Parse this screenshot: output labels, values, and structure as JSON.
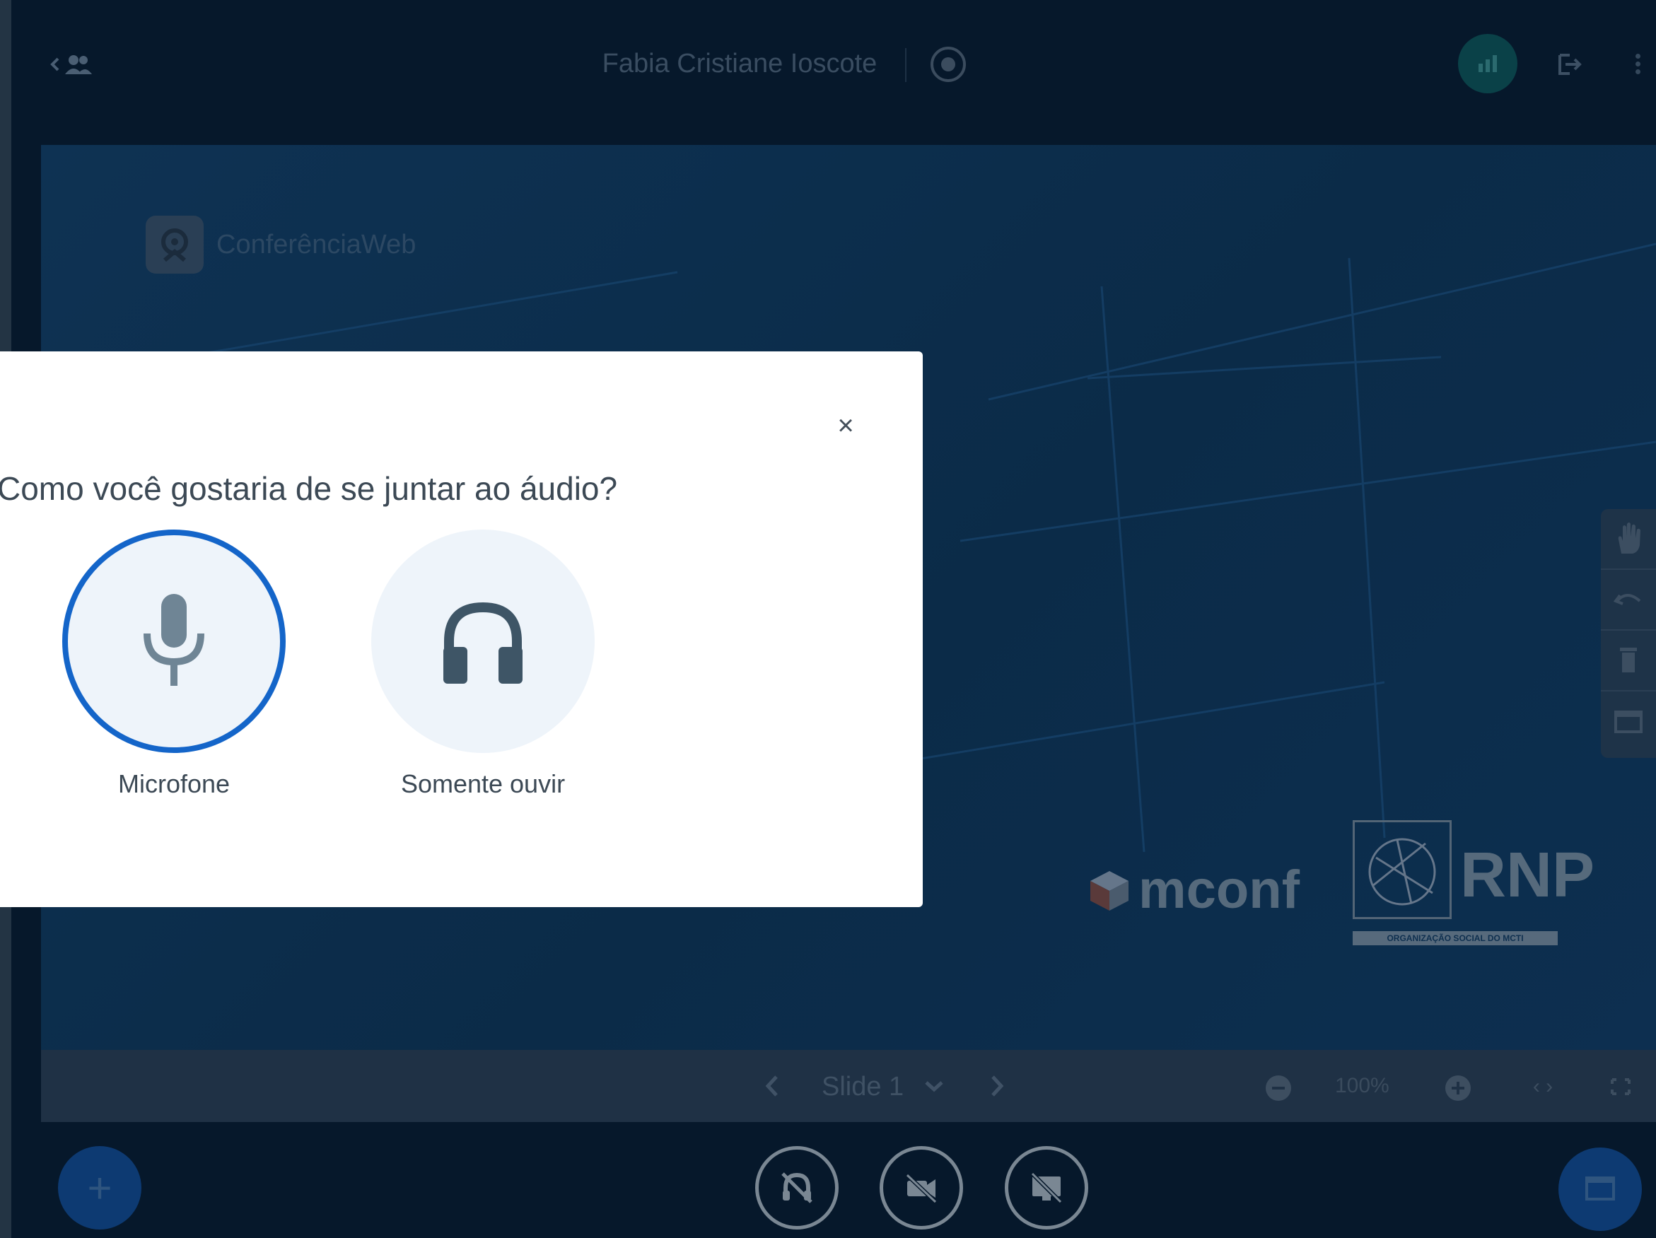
{
  "meeting": {
    "title": "Fabia Cristiane Ioscote"
  },
  "presentation": {
    "brand_text": "ConferênciaWeb",
    "mconf_text": "mconf",
    "rnp_text": "RNP",
    "rnp_subtitle": "ORGANIZAÇÃO SOCIAL DO MCTI"
  },
  "slide_controls": {
    "slide_label": "Slide 1",
    "zoom": "100%",
    "fit_width_glyph": "‹ ›"
  },
  "actions": {
    "plus_glyph": "+"
  },
  "audio_modal": {
    "close_glyph": "×",
    "title": "Como você gostaria de se juntar ao áudio?",
    "options": [
      {
        "label": "Microfone",
        "icon": "microphone-icon",
        "selected": true
      },
      {
        "label": "Somente ouvir",
        "icon": "headphones-icon",
        "selected": false
      }
    ]
  },
  "colors": {
    "accent": "#1465c9",
    "notification_accent": "#00b5cc",
    "background": "#06182b",
    "modal_bg": "#ffffff"
  }
}
